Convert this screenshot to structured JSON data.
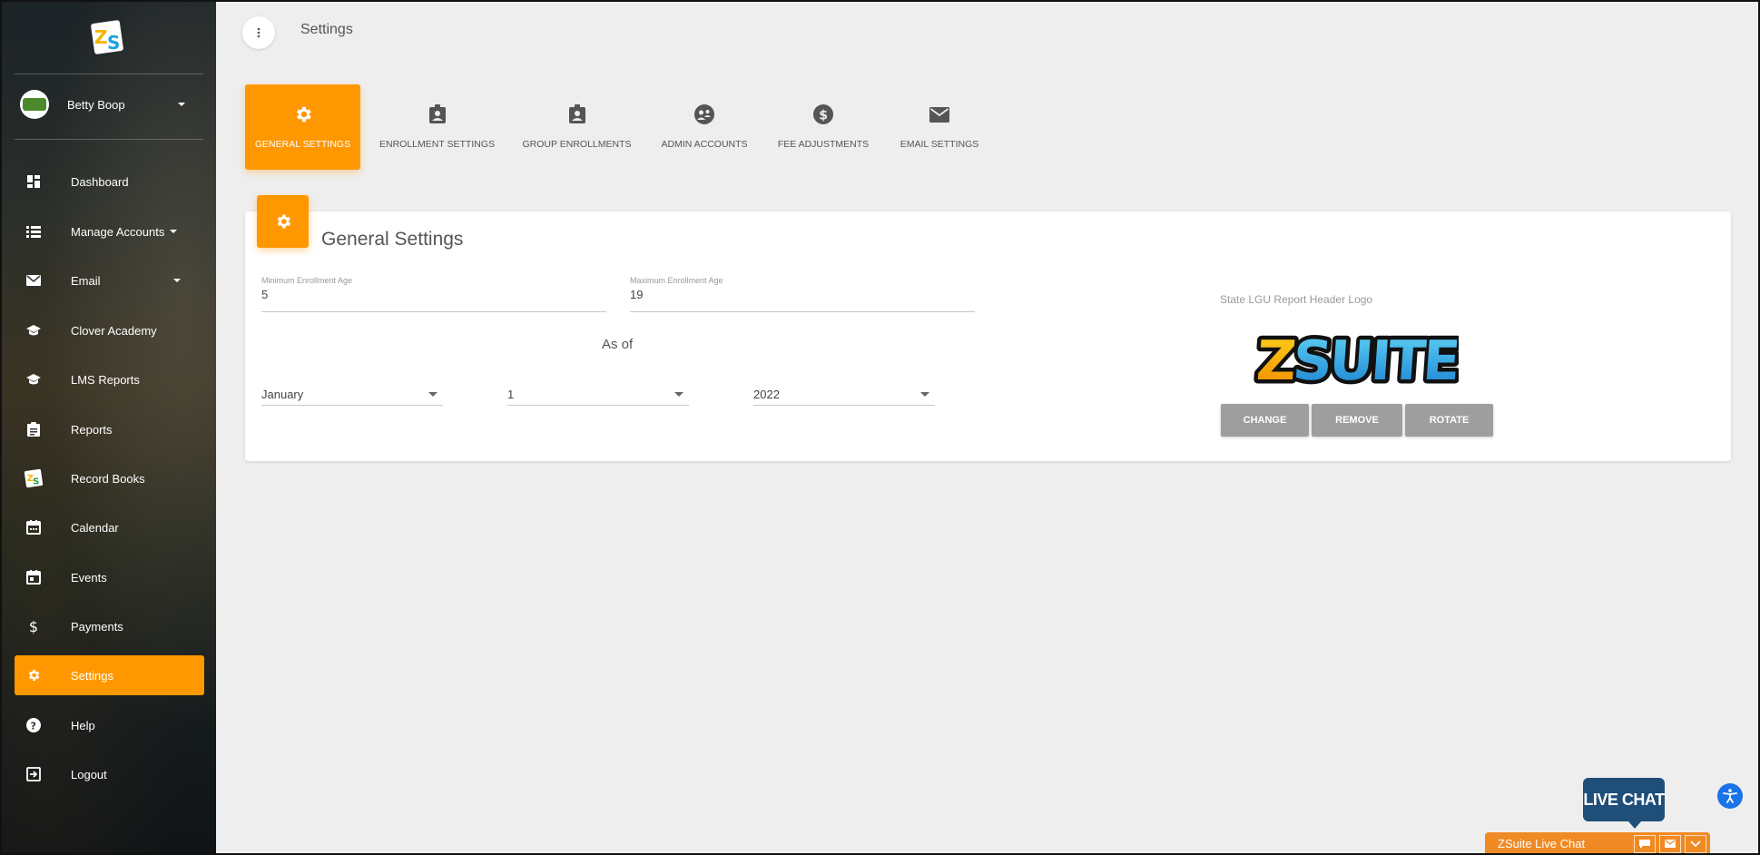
{
  "sidebar": {
    "user_name": "Betty Boop",
    "items": [
      {
        "label": "Dashboard",
        "icon": "dashboard-icon"
      },
      {
        "label": "Manage Accounts",
        "icon": "list-icon"
      },
      {
        "label": "Email",
        "icon": "email-icon"
      },
      {
        "label": "Clover Academy",
        "icon": "graduation-cap-icon"
      },
      {
        "label": "LMS Reports",
        "icon": "graduation-cap-icon"
      },
      {
        "label": "Reports",
        "icon": "clipboard-icon"
      },
      {
        "label": "Record Books",
        "icon": "record-books-icon"
      },
      {
        "label": "Calendar",
        "icon": "calendar-icon"
      },
      {
        "label": "Events",
        "icon": "event-icon"
      },
      {
        "label": "Payments",
        "icon": "dollar-icon"
      },
      {
        "label": "Settings",
        "icon": "gear-icon"
      },
      {
        "label": "Help",
        "icon": "help-icon"
      },
      {
        "label": "Logout",
        "icon": "logout-icon"
      }
    ],
    "active_item": "Settings",
    "accent_color": "#ff9800"
  },
  "header": {
    "title": "Settings"
  },
  "tabs": [
    {
      "label": "GENERAL SETTINGS",
      "icon": "gear-icon",
      "active": true
    },
    {
      "label": "ENROLLMENT SETTINGS",
      "icon": "badge-icon",
      "active": false
    },
    {
      "label": "GROUP ENROLLMENTS",
      "icon": "badge-icon",
      "active": false
    },
    {
      "label": "ADMIN ACCOUNTS",
      "icon": "admin-group-icon",
      "active": false
    },
    {
      "label": "FEE ADJUSTMENTS",
      "icon": "dollar-circle-icon",
      "active": false
    },
    {
      "label": "EMAIL SETTINGS",
      "icon": "email-icon",
      "active": false
    }
  ],
  "card": {
    "title": "General Settings",
    "min_age": {
      "label": "Minimum Enrollment Age",
      "value": "5"
    },
    "max_age": {
      "label": "Maximum Enrollment Age",
      "value": "19"
    },
    "as_of_label": "As of",
    "month": "January",
    "day": "1",
    "year": "2022",
    "logo_label": "State LGU Report Header Logo",
    "logo_text": "ZSUITE",
    "buttons": {
      "change": "CHANGE",
      "remove": "REMOVE",
      "rotate": "ROTATE"
    }
  },
  "live_chat": {
    "badge": "LIVE CHAT",
    "bar_label": "ZSuite Live Chat",
    "badge_color": "#1f4e79",
    "bar_color": "#f08a24"
  }
}
